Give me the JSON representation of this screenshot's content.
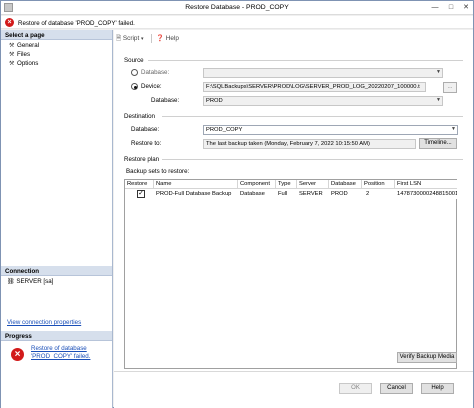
{
  "window": {
    "title": "Restore Database - PROD_COPY"
  },
  "error_bar": {
    "message": "Restore of database 'PROD_COPY' failed."
  },
  "select_page": {
    "header": "Select a page",
    "items": [
      {
        "label": "General"
      },
      {
        "label": "Files"
      },
      {
        "label": "Options"
      }
    ]
  },
  "toolbar": {
    "script_label": "Script",
    "help_label": "Help"
  },
  "source": {
    "group_label": "Source",
    "database_radio": "Database:",
    "device_radio": "Device:",
    "device_path": "F:\\SQLBackups\\SERVER\\PROD\\LOG\\SERVER_PROD_LOG_20220207_100000.t",
    "database_label": "Database:",
    "database_value": "PROD",
    "browse_label": "..."
  },
  "destination": {
    "group_label": "Destination",
    "database_label": "Database:",
    "database_value": "PROD_COPY",
    "restore_to_label": "Restore to:",
    "restore_to_value": "The last backup taken (Monday, February 7, 2022 10:15:50 AM)",
    "timeline_label": "Timeline..."
  },
  "restore_plan": {
    "group_label": "Restore plan",
    "sets_label": "Backup sets to restore:",
    "columns": [
      "Restore",
      "Name",
      "Component",
      "Type",
      "Server",
      "Database",
      "Position",
      "First LSN"
    ],
    "rows": [
      [
        "",
        "PROD-Full Database Backup",
        "Database",
        "Full",
        "SERVER",
        "PROD",
        "2",
        "1478730000248815001"
      ]
    ],
    "verify_label": "Verify Backup Media"
  },
  "connection": {
    "header": "Connection",
    "server": "SERVER [sa]",
    "link": "View connection properties"
  },
  "progress": {
    "header": "Progress",
    "message_line1": "Restore of database",
    "message_line2": "'PROD_COPY' failed."
  },
  "buttons": {
    "ok": "OK",
    "cancel": "Cancel",
    "help": "Help"
  }
}
